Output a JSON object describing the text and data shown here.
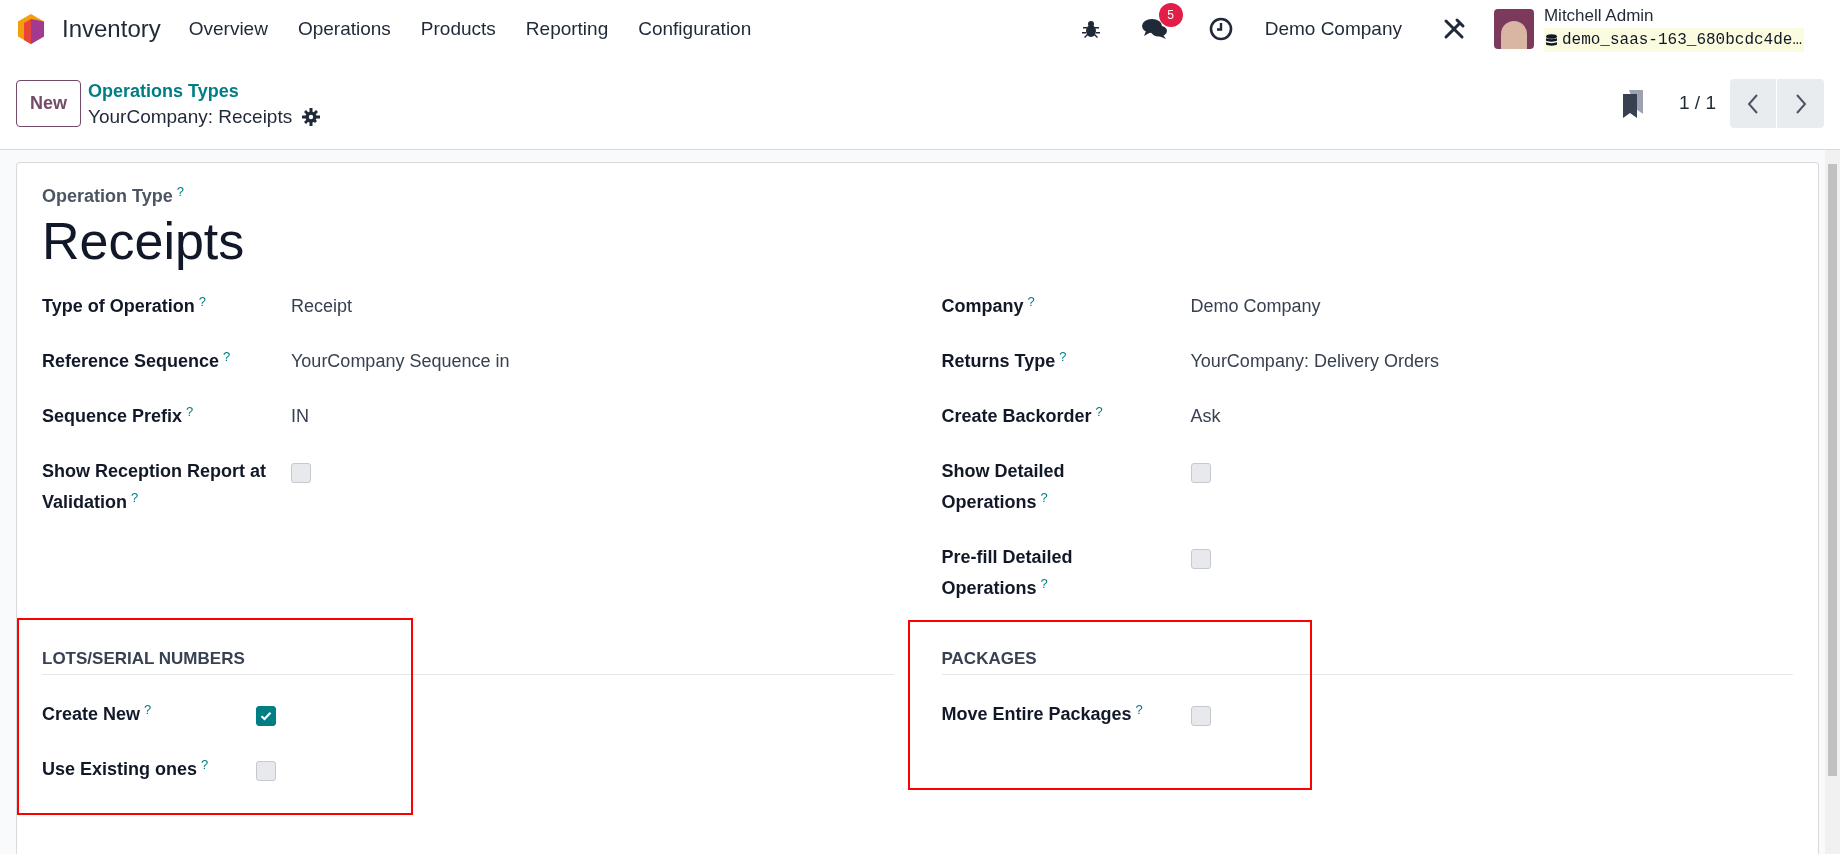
{
  "navbar": {
    "app_name": "Inventory",
    "menu": [
      {
        "label": "Overview"
      },
      {
        "label": "Operations"
      },
      {
        "label": "Products"
      },
      {
        "label": "Reporting"
      },
      {
        "label": "Configuration"
      }
    ],
    "messages_badge": "5",
    "company": "Demo Company",
    "user": {
      "name": "Mitchell Admin",
      "database": "demo_saas-163_680bcdc4de…"
    }
  },
  "control_panel": {
    "new_button": "New",
    "breadcrumb": {
      "parent": "Operations Types",
      "current": "YourCompany: Receipts"
    },
    "pager": "1 / 1"
  },
  "form": {
    "name_label": "Operation Type",
    "name_help": "?",
    "name": "Receipts",
    "columns": [
      [
        {
          "kind": "text",
          "label": "Type of Operation",
          "help": "?",
          "value": "Receipt"
        },
        {
          "kind": "text",
          "label": "Reference Sequence",
          "help": "?",
          "value": "YourCompany Sequence in"
        },
        {
          "kind": "text",
          "label": "Sequence Prefix",
          "help": "?",
          "value": "IN"
        },
        {
          "kind": "checkbox",
          "label": "Show Reception Report at Validation",
          "help": "?",
          "checked": false
        }
      ],
      [
        {
          "kind": "text",
          "label": "Company",
          "help": "?",
          "value": "Demo Company"
        },
        {
          "kind": "text",
          "label": "Returns Type",
          "help": "?",
          "value": "YourCompany: Delivery Orders"
        },
        {
          "kind": "text",
          "label": "Create Backorder",
          "help": "?",
          "value": "Ask"
        },
        {
          "kind": "checkbox",
          "label": "Show Detailed Operations",
          "help": "?",
          "checked": false
        },
        {
          "kind": "checkbox",
          "label": "Pre-fill Detailed Operations",
          "help": "?",
          "checked": false
        }
      ]
    ],
    "sections": [
      {
        "title": "LOTS/SERIAL NUMBERS",
        "highlighted": true,
        "fields": [
          {
            "kind": "checkbox",
            "label": "Create New",
            "help": "?",
            "checked": true
          },
          {
            "kind": "checkbox",
            "label": "Use Existing ones",
            "help": "?",
            "checked": false
          }
        ]
      },
      {
        "title": "PACKAGES",
        "highlighted": true,
        "fields": [
          {
            "kind": "checkbox",
            "label": "Move Entire Packages",
            "help": "?",
            "checked": false
          }
        ]
      }
    ]
  }
}
